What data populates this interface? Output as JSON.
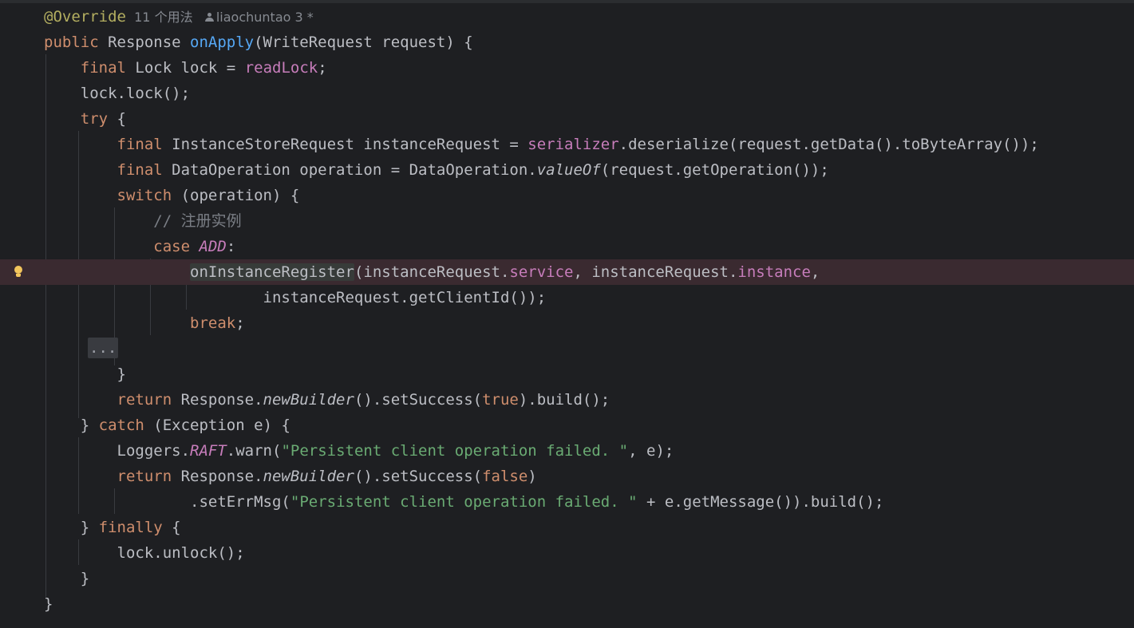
{
  "inlay_hint": {
    "usages": "11 个用法",
    "author": "liaochuntao 3 *"
  },
  "code": {
    "l0_annotation": "@Override",
    "l1_kw_public": "public",
    "l1_type": " Response ",
    "l1_method": "onApply",
    "l1_params": "(WriteRequest request) {",
    "l2_kw_final": "final",
    "l2_decl": " Lock lock = ",
    "l2_field": "readLock",
    "l2_end": ";",
    "l3": "lock.lock();",
    "l4_kw_try": "try",
    "l4_brace": " {",
    "l5_kw_final": "final",
    "l5_decl": " InstanceStoreRequest instanceRequest = ",
    "l5_field": "serializer",
    "l5_rest": ".deserialize(request.getData().toByteArray());",
    "l6_kw_final": "final",
    "l6_decl": " DataOperation operation = DataOperation.",
    "l6_static": "valueOf",
    "l6_rest": "(request.getOperation());",
    "l7_kw_switch": "switch",
    "l7_rest": " (operation) {",
    "l8_comment": "// 注册实例",
    "l9_kw_case": "case",
    "l9_space": " ",
    "l9_const": "ADD",
    "l9_colon": ":",
    "l10_call": "onInstanceRegister",
    "l10_a": "(instanceRequest.",
    "l10_field1": "service",
    "l10_b": ", instanceRequest.",
    "l10_field2": "instance",
    "l10_c": ",",
    "l11": "instanceRequest.getClientId());",
    "l12_kw_break": "break",
    "l12_end": ";",
    "l13_fold": "...",
    "l14_brace": "}",
    "l15_kw_return": "return",
    "l15_a": " Response.",
    "l15_static": "newBuilder",
    "l15_b": "().setSuccess(",
    "l15_kw_true": "true",
    "l15_c": ").build();",
    "l16_brace": "} ",
    "l16_kw_catch": "catch",
    "l16_rest": " (Exception e) {",
    "l17_a": "Loggers.",
    "l17_const": "RAFT",
    "l17_b": ".warn(",
    "l17_str": "\"Persistent client operation failed. \"",
    "l17_c": ", e);",
    "l18_kw_return": "return",
    "l18_a": " Response.",
    "l18_static": "newBuilder",
    "l18_b": "().setSuccess(",
    "l18_kw_false": "false",
    "l18_c": ")",
    "l19_a": ".setErrMsg(",
    "l19_str": "\"Persistent client operation failed. \"",
    "l19_b": " + e.getMessage()).build();",
    "l20_brace": "} ",
    "l20_kw_finally": "finally",
    "l20_rest": " {",
    "l21": "lock.unlock();",
    "l22_brace": "}",
    "l23_brace": "}"
  },
  "colors": {
    "background": "#1e1f22",
    "keyword": "#cf8e6d",
    "annotation": "#b3ae60",
    "method_declaration": "#56a8f5",
    "field": "#c77dbb",
    "string": "#6aab73",
    "comment": "#7a7e85",
    "text": "#bcbec4",
    "highlighted_line": "#3a2a30",
    "intention_bulb": "#f2c55c"
  },
  "icons": {
    "gutter": "intention-bulb-icon",
    "author_hint": "person-icon"
  }
}
